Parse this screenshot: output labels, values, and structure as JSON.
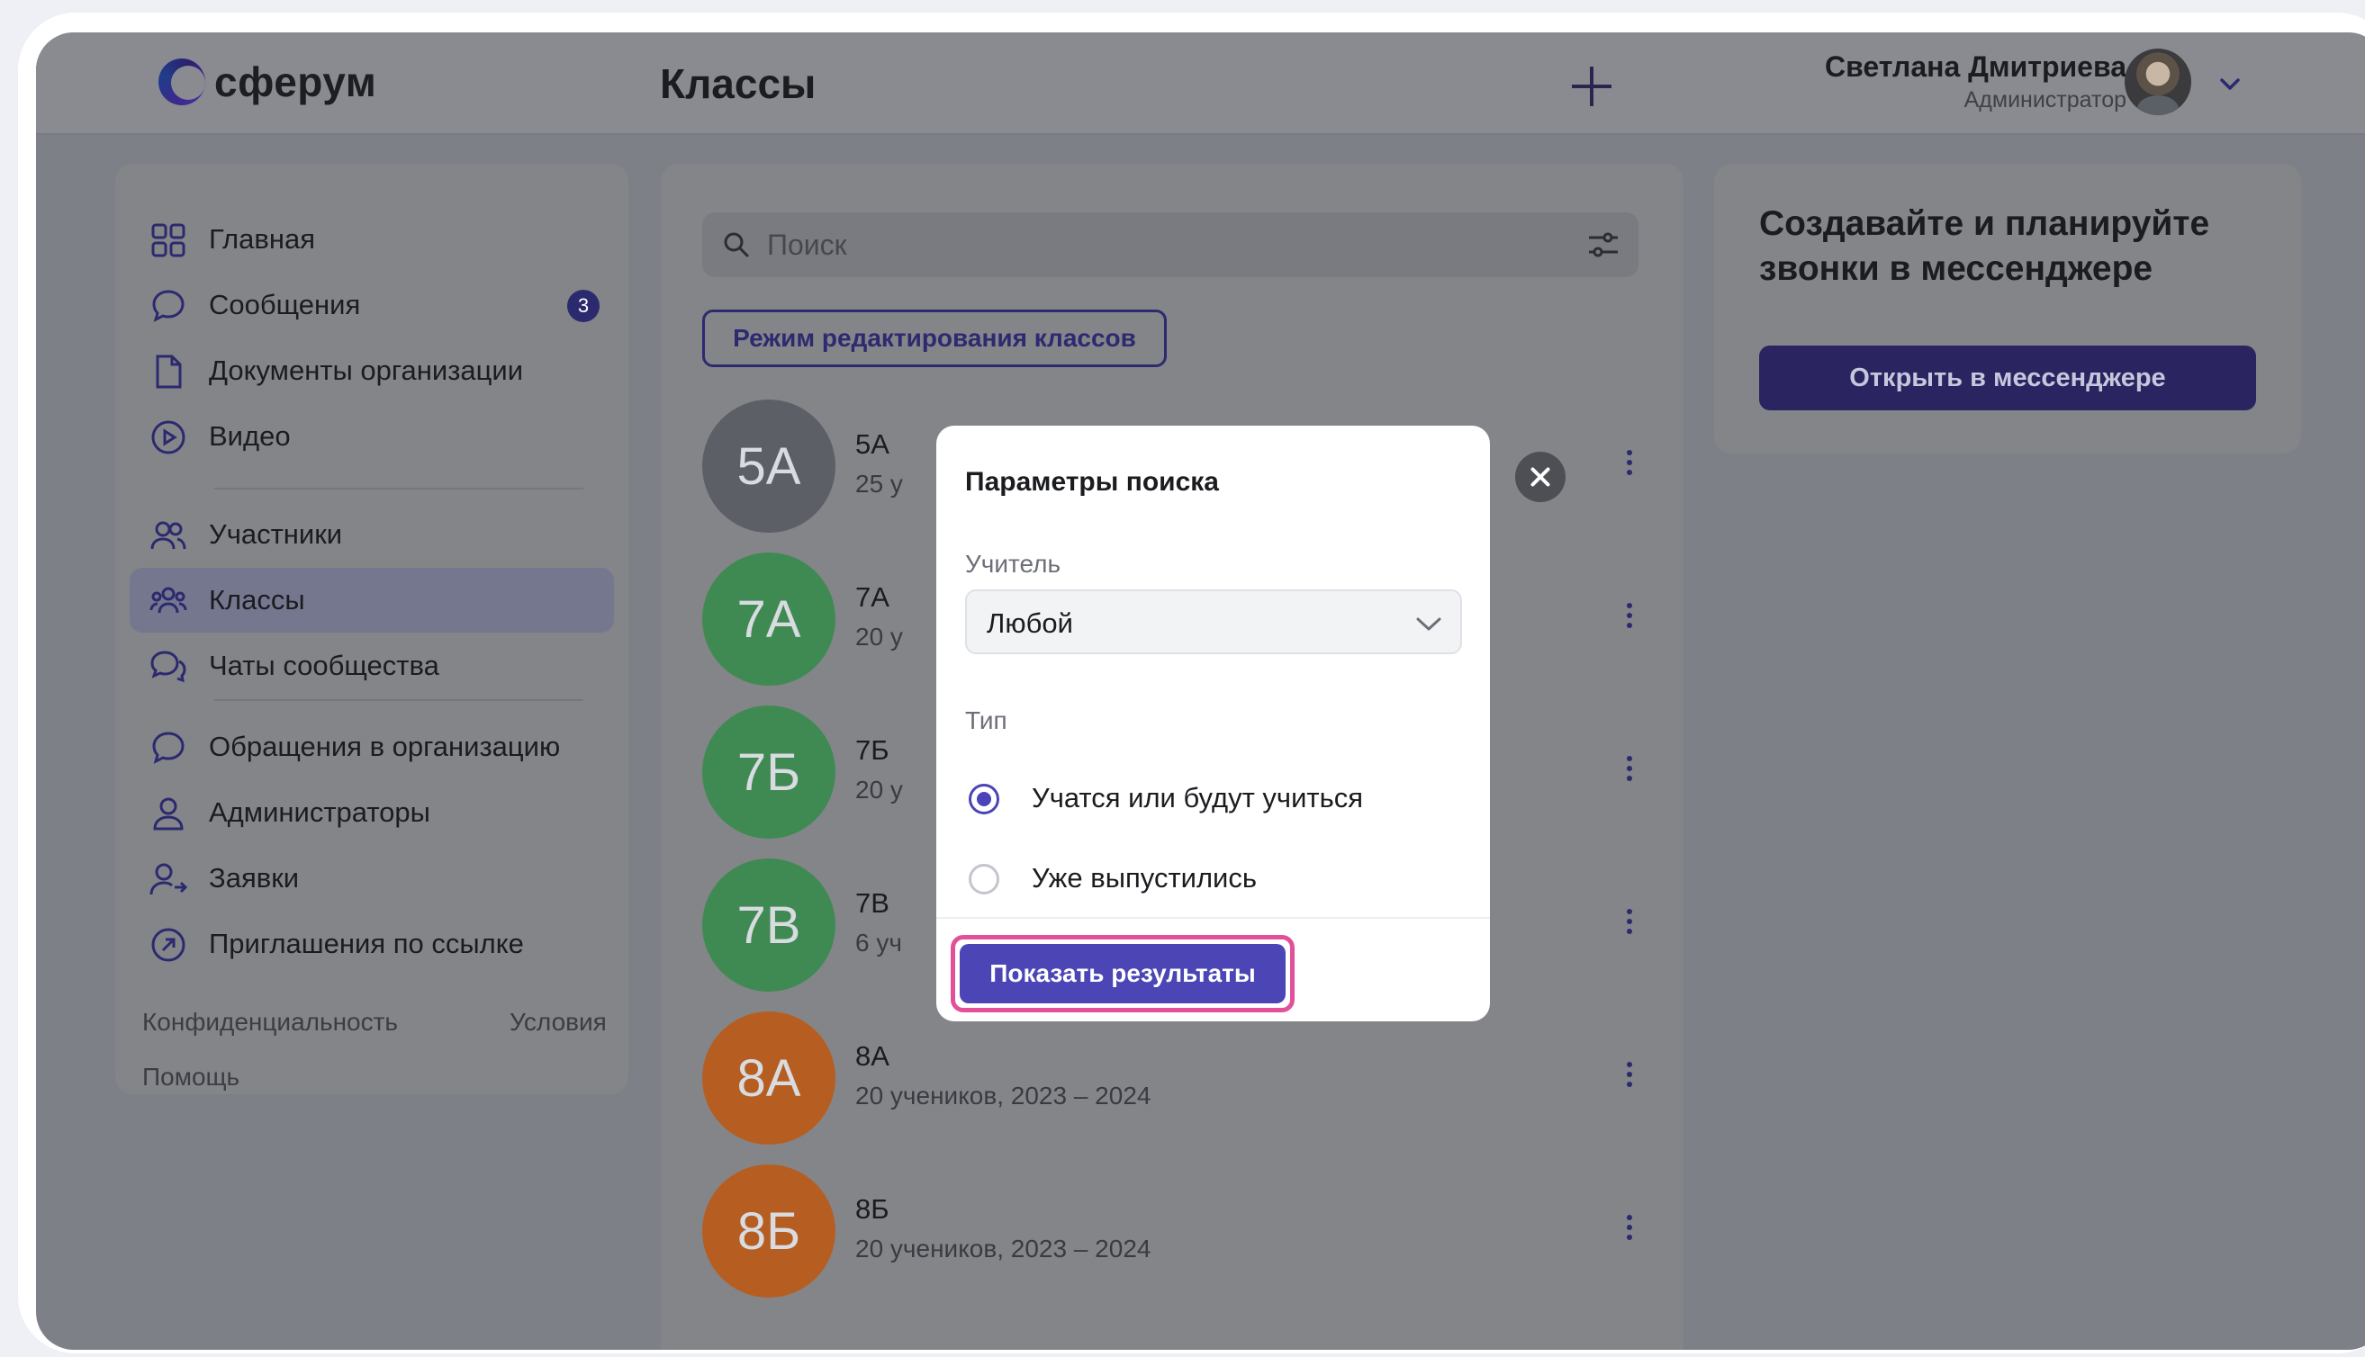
{
  "app": {
    "logo_text": "сферум",
    "page_title": "Классы",
    "user": {
      "name": "Светлана Дмитриева",
      "role": "Администратор"
    }
  },
  "sidebar": {
    "items": [
      {
        "label": "Главная",
        "icon": "grid-icon"
      },
      {
        "label": "Сообщения",
        "icon": "chat-bubble-icon",
        "badge": "3"
      },
      {
        "label": "Документы организации",
        "icon": "document-icon"
      },
      {
        "label": "Видео",
        "icon": "play-circle-icon"
      },
      {
        "label": "Участники",
        "icon": "users-icon"
      },
      {
        "label": "Классы",
        "icon": "group-icon",
        "active": true
      },
      {
        "label": "Чаты сообщества",
        "icon": "chats-icon"
      },
      {
        "label": "Обращения в организацию",
        "icon": "chat-bubble-icon"
      },
      {
        "label": "Администраторы",
        "icon": "user-icon"
      },
      {
        "label": "Заявки",
        "icon": "user-arrow-icon"
      },
      {
        "label": "Приглашения по ссылке",
        "icon": "link-circle-icon"
      }
    ],
    "footer": {
      "privacy": "Конфиденциальность",
      "terms": "Условия",
      "help": "Помощь"
    }
  },
  "main": {
    "search_placeholder": "Поиск",
    "edit_mode_label": "Режим редактирования классов",
    "classes": [
      {
        "initials": "5А",
        "name": "5А",
        "meta": "25 у",
        "color": "#5d5f67"
      },
      {
        "initials": "7А",
        "name": "7А",
        "meta": "20 у",
        "color": "#3f8a52"
      },
      {
        "initials": "7Б",
        "name": "7Б",
        "meta": "20 у",
        "color": "#3f8a52"
      },
      {
        "initials": "7В",
        "name": "7В",
        "meta": "6 уч",
        "color": "#3f8a52"
      },
      {
        "initials": "8А",
        "name": "8А",
        "meta": "20 учеников,  2023 – 2024",
        "color": "#b65e22"
      },
      {
        "initials": "8Б",
        "name": "8Б",
        "meta": "20 учеников,  2023 – 2024",
        "color": "#b65e22"
      }
    ]
  },
  "promo": {
    "title": "Создавайте и планируйте звонки в мессенджере",
    "button": "Открыть в мессенджере"
  },
  "modal": {
    "title": "Параметры поиска",
    "teacher_label": "Учитель",
    "teacher_value": "Любой",
    "type_label": "Тип",
    "options": [
      {
        "label": "Учатся или будут учиться",
        "checked": true
      },
      {
        "label": "Уже выпустились",
        "checked": false
      }
    ],
    "submit": "Показать результаты"
  },
  "colors": {
    "accent": "#4b45b5",
    "highlight": "#e3509a",
    "dark_button": "#2a2560"
  }
}
